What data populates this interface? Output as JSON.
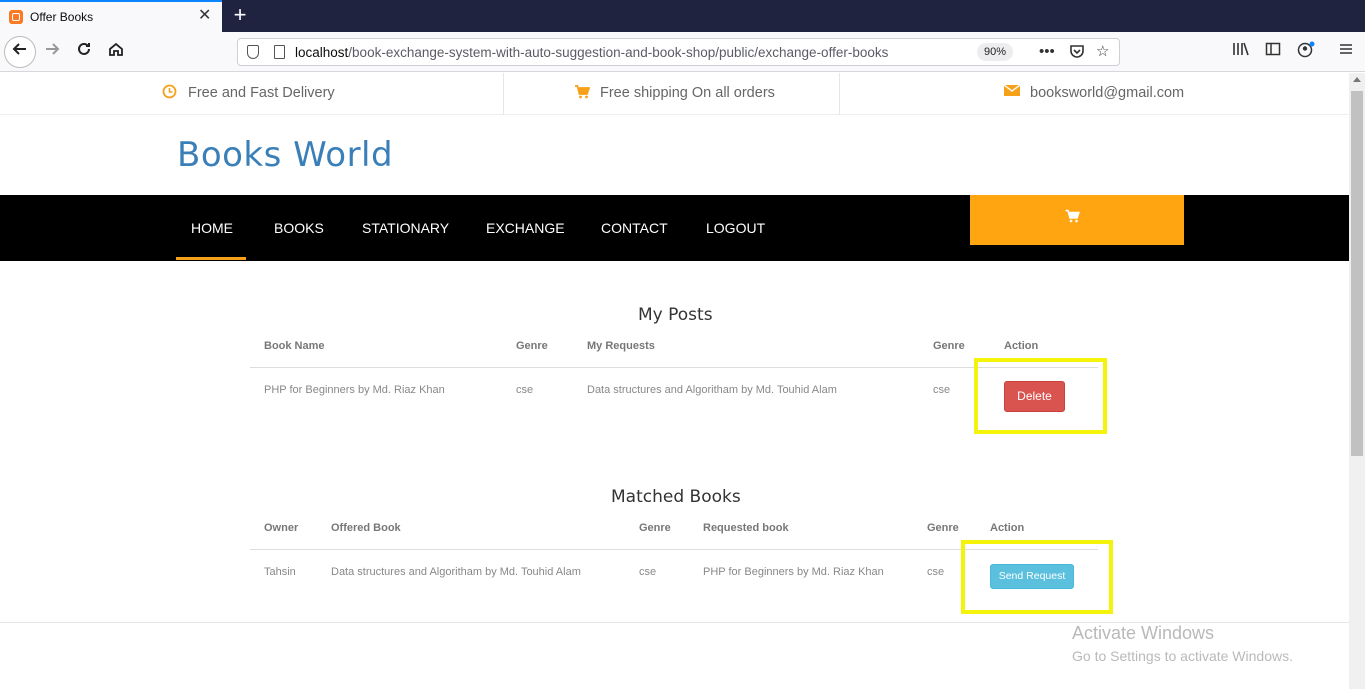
{
  "browser": {
    "tab_title": "Offer Books",
    "tab_close": "✕",
    "new_tab": "+",
    "url_host": "localhost",
    "url_path": "/book-exchange-system-with-auto-suggestion-and-book-shop/public/exchange-offer-books",
    "zoom": "90%"
  },
  "topinfo": {
    "delivery": "Free and Fast Delivery",
    "shipping": "Free shipping On all orders",
    "email": "booksworld@gmail.com"
  },
  "brand": "Books World",
  "nav": {
    "items": [
      "HOME",
      "BOOKS",
      "STATIONARY",
      "EXCHANGE",
      "CONTACT",
      "LOGOUT"
    ],
    "active": "HOME"
  },
  "my_posts": {
    "title": "My Posts",
    "headers": [
      "Book Name",
      "Genre",
      "My Requests",
      "Genre",
      "Action"
    ],
    "rows": [
      {
        "book_name": "PHP for Beginners by Md. Riaz Khan",
        "genre": "cse",
        "request": "Data structures and Algoritham by Md. Touhid Alam",
        "request_genre": "cse",
        "action": "Delete"
      }
    ]
  },
  "matched_books": {
    "title": "Matched Books",
    "headers": [
      "Owner",
      "Offered Book",
      "Genre",
      "Requested book",
      "Genre",
      "Action"
    ],
    "rows": [
      {
        "owner": "Tahsin",
        "offered_book": "Data structures and Algoritham by Md. Touhid Alam",
        "genre": "cse",
        "requested_book": "PHP for Beginners by Md. Riaz Khan",
        "requested_genre": "cse",
        "action": "Send Request"
      }
    ]
  },
  "watermark": {
    "line1": "Activate Windows",
    "line2": "Go to Settings to activate Windows."
  },
  "colors": {
    "accent_orange": "#ffa511",
    "brand_blue": "#3a7fb8",
    "delete_red": "#d9534f",
    "send_blue": "#5bc0de",
    "highlight_yellow": "#f6f30b"
  }
}
